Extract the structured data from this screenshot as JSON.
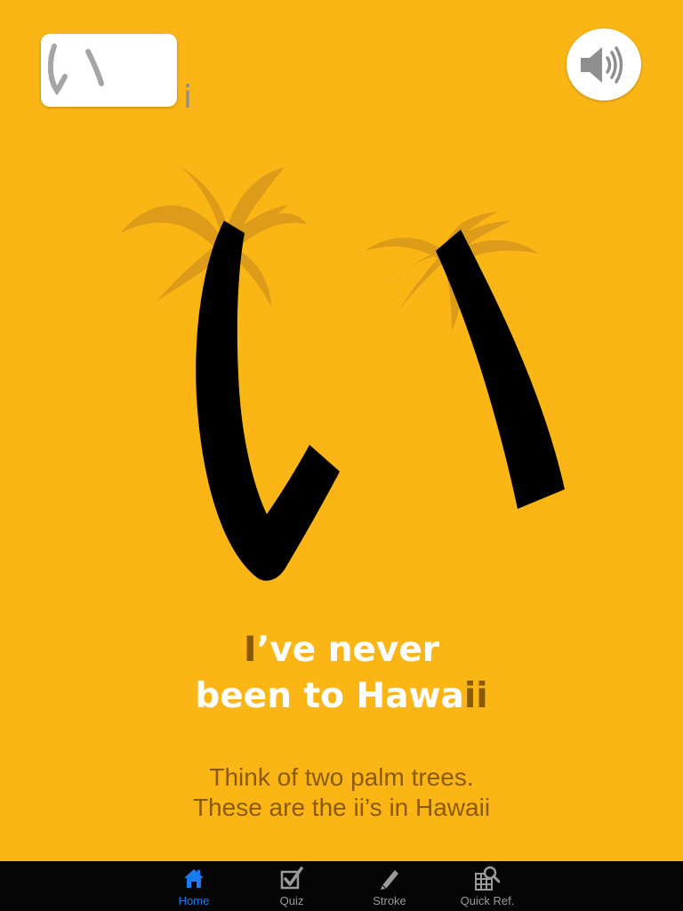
{
  "kana_card": {
    "kana": "い",
    "romaji": "i"
  },
  "sound_button": {
    "icon": "speaker-icon"
  },
  "illustration": {
    "kana": "い",
    "icons": [
      "palm-tree-icon",
      "palm-tree-icon"
    ]
  },
  "mnemonic": {
    "line1_highlight": "I",
    "line1_rest": "’ve never",
    "line2_prefix": "been to Hawa",
    "line2_highlight": "ii"
  },
  "description": {
    "line1": "Think of two palm trees.",
    "line2": "These are the ii’s in Hawaii"
  },
  "tabbar": {
    "tabs": [
      {
        "label": "Home",
        "icon": "home-icon",
        "active": true
      },
      {
        "label": "Quiz",
        "icon": "quiz-checkbox-icon",
        "active": false
      },
      {
        "label": "Stroke",
        "icon": "pencil-icon",
        "active": false
      },
      {
        "label": "Quick Ref.",
        "icon": "grid-search-icon",
        "active": false
      }
    ]
  },
  "colors": {
    "background": "#fbb615",
    "highlight": "#8a5a00",
    "tab_active": "#1a7cf5",
    "tab_inactive": "#9a9a9a"
  }
}
